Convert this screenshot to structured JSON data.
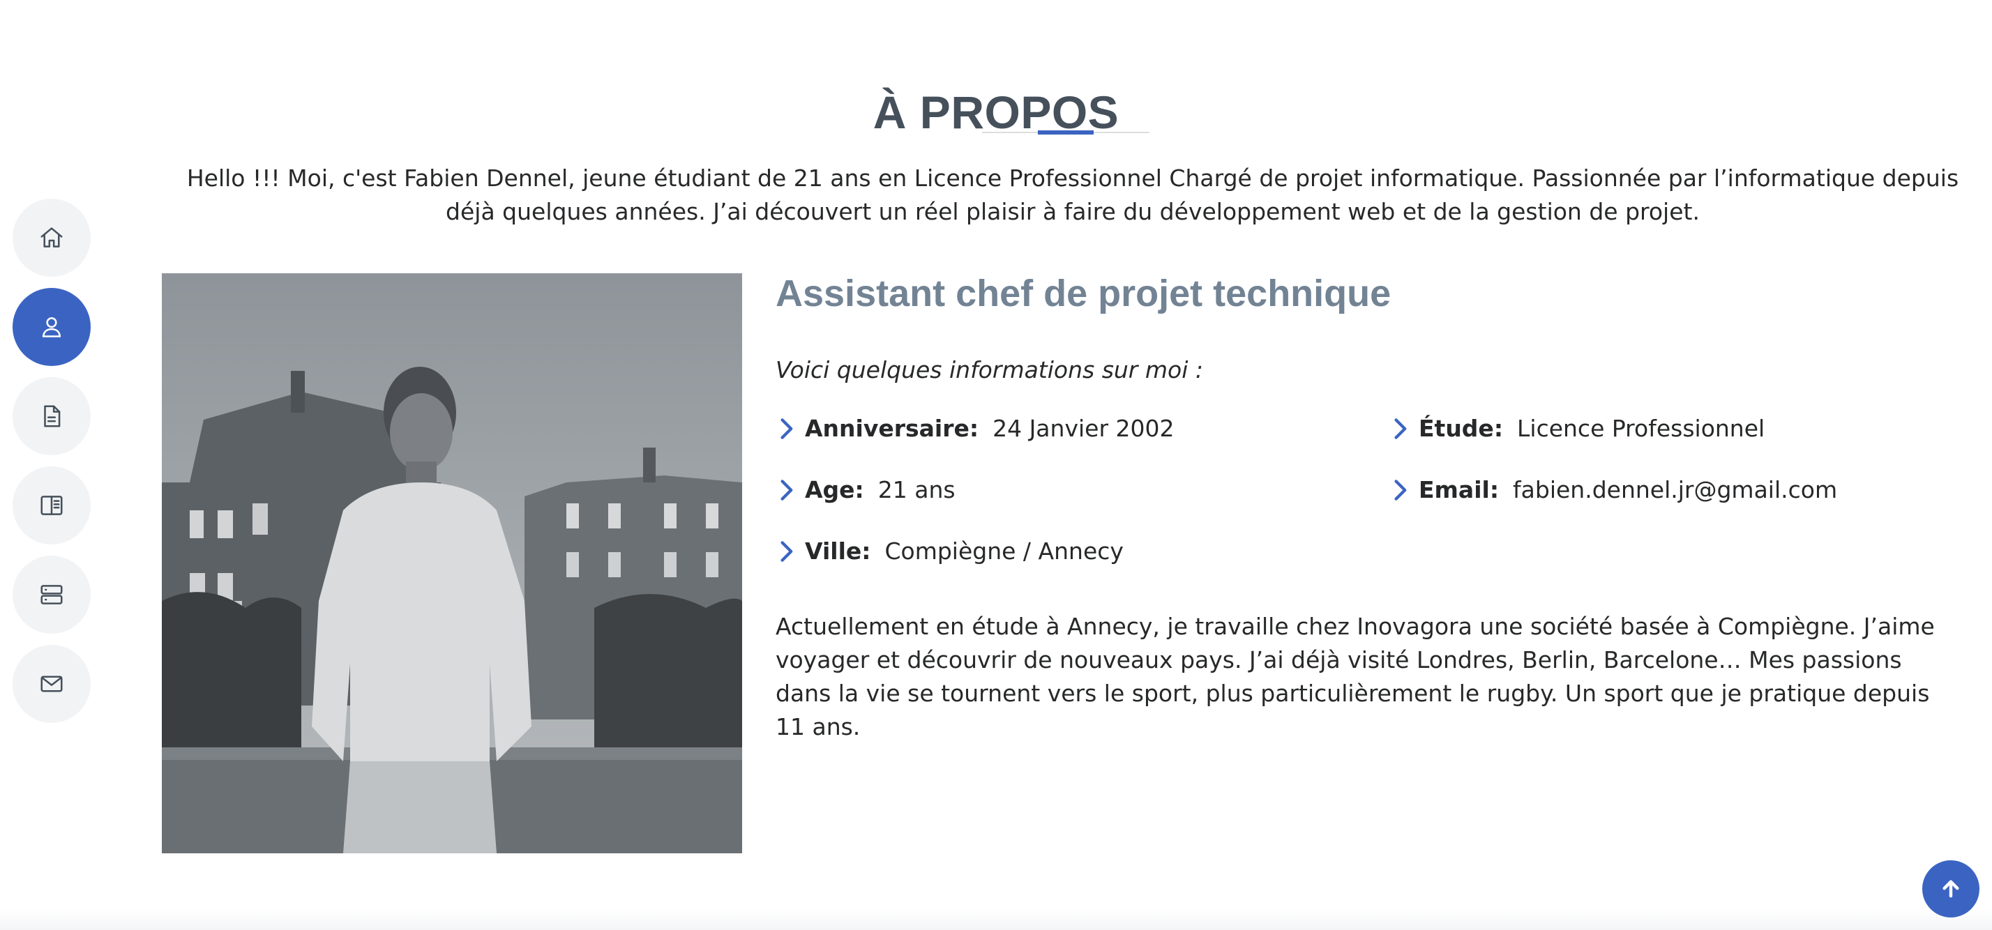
{
  "section": {
    "title": "À PROPOS",
    "intro": "Hello !!! Moi, c'est Fabien Dennel, jeune étudiant de 21 ans en Licence Professionnel Chargé de projet informatique. Passionnée par l’informatique depuis déjà quelques années. J’ai découvert un réel plaisir à faire du développement web et de la gestion de projet."
  },
  "nav": {
    "items": [
      {
        "icon": "home-icon",
        "active": false
      },
      {
        "icon": "user-icon",
        "active": true
      },
      {
        "icon": "document-icon",
        "active": false
      },
      {
        "icon": "book-icon",
        "active": false
      },
      {
        "icon": "server-icon",
        "active": false
      },
      {
        "icon": "envelope-icon",
        "active": false
      }
    ]
  },
  "about": {
    "role": "Assistant chef de projet technique",
    "tagline": "Voici quelques informations sur moi :",
    "facts": {
      "birthday": {
        "label": "Anniversaire:",
        "value": "24 Janvier 2002"
      },
      "study": {
        "label": "Étude:",
        "value": "Licence Professionnel"
      },
      "age": {
        "label": "Age:",
        "value": "21 ans"
      },
      "email": {
        "label": "Email:",
        "value": "fabien.dennel.jr@gmail.com"
      },
      "city": {
        "label": "Ville:",
        "value": "Compiègne / Annecy"
      }
    },
    "bio": "Actuellement en étude à Annecy, je travaille chez Inovagora une société basée à Compiègne. J’aime voyager et découvrir de nouveaux pays. J’ai déjà visité Londres, Berlin, Barcelone… Mes passions dans la vie se tournent vers le sport, plus particulièrement le rugby. Un sport que je pratique depuis 11 ans."
  },
  "colors": {
    "accent": "#3b64c2",
    "title": "#45505b",
    "role": "#728394",
    "text": "#272829"
  }
}
